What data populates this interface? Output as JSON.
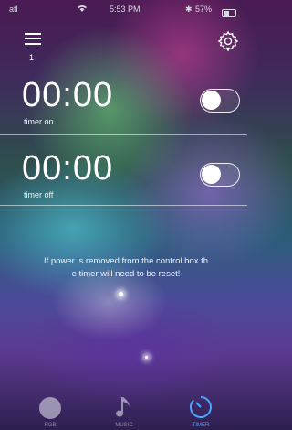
{
  "status_bar": {
    "signal": "atl",
    "time": "5:53 PM",
    "battery": "57%"
  },
  "header": {
    "menu_count": "1"
  },
  "timers": [
    {
      "time": "00:00",
      "label": "timer on",
      "enabled": false
    },
    {
      "time": "00:00",
      "label": "timer off",
      "enabled": false
    }
  ],
  "warning_text_line1": "If power is removed from the control box th",
  "warning_text_line2": "e timer will need to be reset!",
  "tabs": [
    {
      "label": "RGB",
      "icon": "circle-icon",
      "active": false
    },
    {
      "label": "MUSIC",
      "icon": "music-note-icon",
      "active": false
    },
    {
      "label": "TIMER",
      "icon": "timer-icon",
      "active": true
    }
  ],
  "colors": {
    "active_tab": "#4aa6ff",
    "toggle_off_knob": "#ffffff"
  }
}
